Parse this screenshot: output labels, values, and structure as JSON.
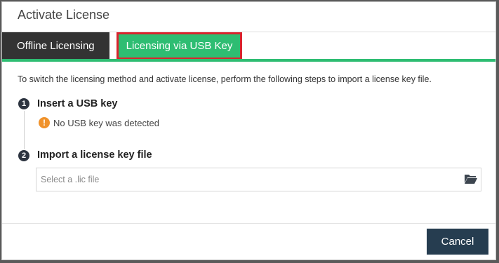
{
  "dialog": {
    "title": "Activate License"
  },
  "tabs": [
    {
      "label": "Offline Licensing",
      "active": false
    },
    {
      "label": "Licensing via USB Key",
      "active": true
    }
  ],
  "instructions": "To switch the licensing method and activate license, perform the following steps to import a license key file.",
  "steps": [
    {
      "number": "1",
      "title": "Insert a USB key",
      "warning_icon": "!",
      "status": "No USB key was detected"
    },
    {
      "number": "2",
      "title": "Import a license key file",
      "file_input": {
        "value": "",
        "placeholder": "Select a .lic file"
      },
      "browse_icon": "folder-open-icon"
    }
  ],
  "footer": {
    "cancel_label": "Cancel"
  },
  "colors": {
    "accent_green": "#2ebd72",
    "highlight_red": "#d9232d",
    "dark_tab": "#333333",
    "step_circle": "#2d3440",
    "warning_orange": "#f0922b",
    "cancel_button": "#263d50"
  }
}
